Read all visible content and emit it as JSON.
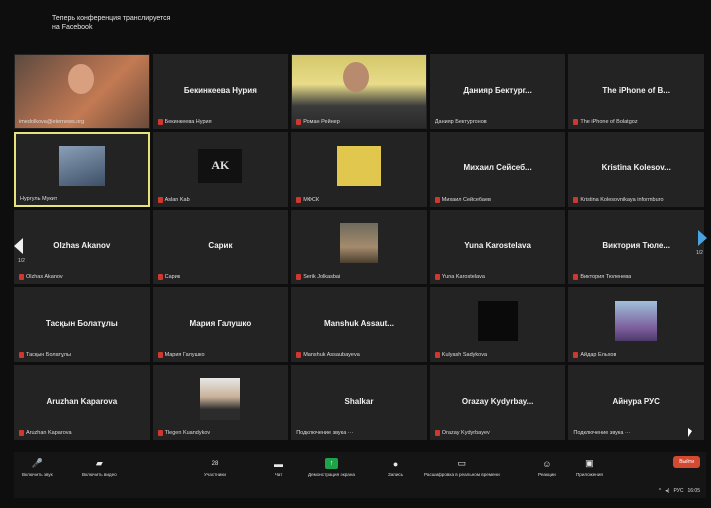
{
  "notice": "Теперь конференция транслируется\nна Facebook",
  "tiles": [
    {
      "big": "",
      "label": "imedolkova@eternews.org",
      "muted": false,
      "kind": "video1"
    },
    {
      "big": "Бекинкеева Нурия",
      "label": "Бекинкеева Нурия",
      "muted": true,
      "kind": "name"
    },
    {
      "big": "",
      "label": "Роман Рейнер",
      "muted": true,
      "kind": "video2"
    },
    {
      "big": "Данияр Бектург...",
      "label": "Данияр Бектургонов",
      "muted": false,
      "kind": "name"
    },
    {
      "big": "The iPhone of B...",
      "label": "The iPhone of Bolatgoz",
      "muted": true,
      "kind": "name"
    },
    {
      "big": "",
      "label": "Нургуль Мукит",
      "muted": false,
      "kind": "photo-dark",
      "active": true
    },
    {
      "big": "",
      "label": "Aslan Kab",
      "muted": true,
      "kind": "logo-ak"
    },
    {
      "big": "",
      "label": "МФСК",
      "muted": true,
      "kind": "photo-yellow"
    },
    {
      "big": "Михаил Сейсеб...",
      "label": "Михаил Сейсебаев",
      "muted": true,
      "kind": "name"
    },
    {
      "big": "Kristina Kolesov...",
      "label": "Kristina Kolesovnikaya informburo",
      "muted": true,
      "kind": "name"
    },
    {
      "big": "Olzhas Akanov",
      "label": "Olzhas Akanov",
      "muted": true,
      "kind": "name"
    },
    {
      "big": "Сарик",
      "label": "Сарик",
      "muted": true,
      "kind": "name"
    },
    {
      "big": "",
      "label": "Serik Jolkasbai",
      "muted": true,
      "kind": "photo-people"
    },
    {
      "big": "Yuna Karostelava",
      "label": "Yuna Karostelava",
      "muted": true,
      "kind": "name"
    },
    {
      "big": "Виктория Тюле...",
      "label": "Виктория Тюленева",
      "muted": true,
      "kind": "name"
    },
    {
      "big": "Тасқын Болатұлы",
      "label": "Тасқын Болатұлы",
      "muted": true,
      "kind": "name"
    },
    {
      "big": "Мария Галушко",
      "label": "Мария Галушко",
      "muted": true,
      "kind": "name"
    },
    {
      "big": "Manshuk Assaut...",
      "label": "Manshuk Assaubayeva",
      "muted": true,
      "kind": "name"
    },
    {
      "big": "",
      "label": "Kulyash Sadykova",
      "muted": true,
      "kind": "photo-black"
    },
    {
      "big": "",
      "label": "Айдар Ельхов",
      "muted": true,
      "kind": "photo-person"
    },
    {
      "big": "Aruzhan Kaparova",
      "label": "Aruzhan Kaparova",
      "muted": true,
      "kind": "name"
    },
    {
      "big": "",
      "label": "Tlegen Kuandykov",
      "muted": true,
      "kind": "photo-portrait"
    },
    {
      "big": "Shalkar",
      "label": "Подключение звука ···",
      "muted": false,
      "kind": "name"
    },
    {
      "big": "Orazay Kydyrbay...",
      "label": "Orazay Kydyrbayev",
      "muted": true,
      "kind": "name"
    },
    {
      "big": "Айнура РУС",
      "label": "Подключение звука ···",
      "muted": false,
      "kind": "name"
    }
  ],
  "page_left": "1/2",
  "page_right": "1/2",
  "toolbar": {
    "unmute": "Включить звук",
    "video": "Включить видео",
    "participants": "Участники",
    "participants_count": "28",
    "chat": "Чат",
    "share": "Демонстрация экрана",
    "record": "Запись",
    "transcript": "Расшифровка в реальном времени",
    "reactions": "Реакции",
    "apps": "Приложения",
    "exit": "Выйти"
  },
  "tray": {
    "lang": "РУС",
    "time": "16:05"
  }
}
